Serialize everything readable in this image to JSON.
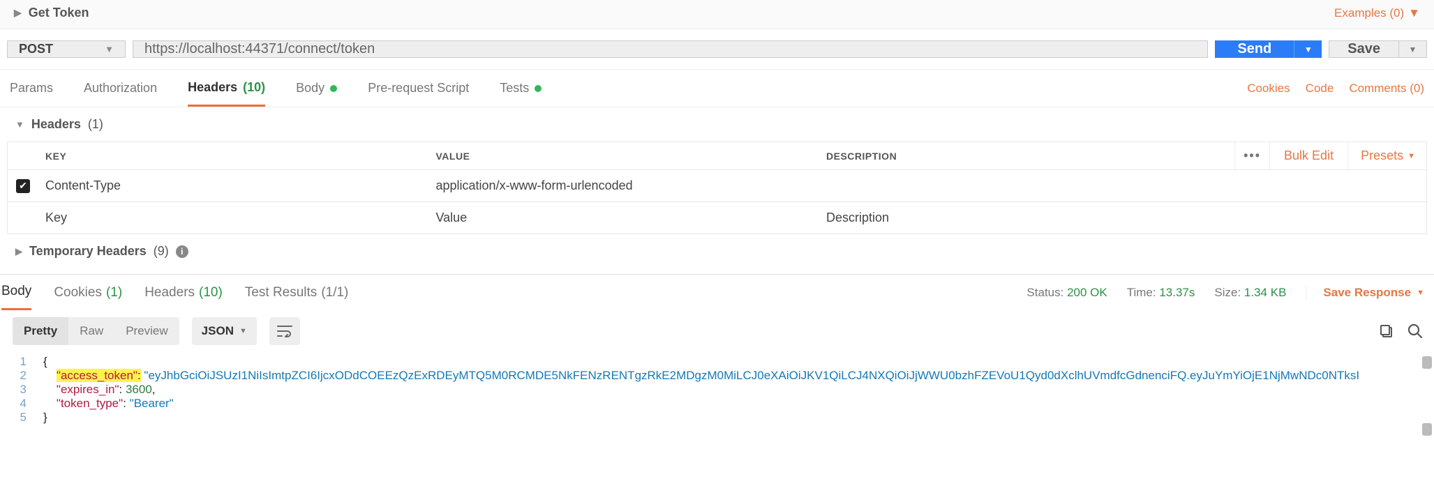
{
  "header": {
    "title": "Get Token",
    "examples_label": "Examples (0)"
  },
  "request": {
    "method": "POST",
    "url": "https://localhost:44371/connect/token",
    "send_label": "Send",
    "save_label": "Save"
  },
  "req_tabs": {
    "params": "Params",
    "authorization": "Authorization",
    "headers": "Headers",
    "headers_count": "(10)",
    "body": "Body",
    "prerequest": "Pre-request Script",
    "tests": "Tests"
  },
  "req_links": {
    "cookies": "Cookies",
    "code": "Code",
    "comments": "Comments (0)"
  },
  "headers_section": {
    "title": "Headers",
    "count": "(1)",
    "cols": {
      "key": "KEY",
      "value": "VALUE",
      "description": "DESCRIPTION"
    },
    "actions": {
      "bulk": "Bulk Edit",
      "presets": "Presets"
    },
    "rows": [
      {
        "checked": true,
        "key": "Content-Type",
        "value": "application/x-www-form-urlencoded",
        "description": ""
      }
    ],
    "placeholders": {
      "key": "Key",
      "value": "Value",
      "description": "Description"
    }
  },
  "temp_headers": {
    "title": "Temporary Headers",
    "count": "(9)"
  },
  "resp_tabs": {
    "body": "Body",
    "cookies": "Cookies",
    "cookies_count": "(1)",
    "headers": "Headers",
    "headers_count": "(10)",
    "tests": "Test Results",
    "tests_count": "(1/1)"
  },
  "resp_meta": {
    "status_label": "Status:",
    "status_value": "200 OK",
    "time_label": "Time:",
    "time_value": "13.37s",
    "size_label": "Size:",
    "size_value": "1.34 KB",
    "save_label": "Save Response"
  },
  "body_toolbar": {
    "pretty": "Pretty",
    "raw": "Raw",
    "preview": "Preview",
    "format": "JSON"
  },
  "response_body": {
    "access_token_key": "access_token",
    "access_token_val": "eyJhbGciOiJSUzI1NiIsImtpZCI6IjcxODdCOEEzQzExRDEyMTQ5M0RCMDE5NkFENzRENTgzRkE2MDgzM0MiLCJ0eXAiOiJKV1QiLCJ4NXQiOiJjWWU0bzhFZEVoU1Qyd0dXclhUVmdfcGdnenciFQ.eyJuYmYiOjE1NjMwNDc0NTksI",
    "expires_in_key": "expires_in",
    "expires_in_val": "3600",
    "token_type_key": "token_type",
    "token_type_val": "Bearer"
  }
}
